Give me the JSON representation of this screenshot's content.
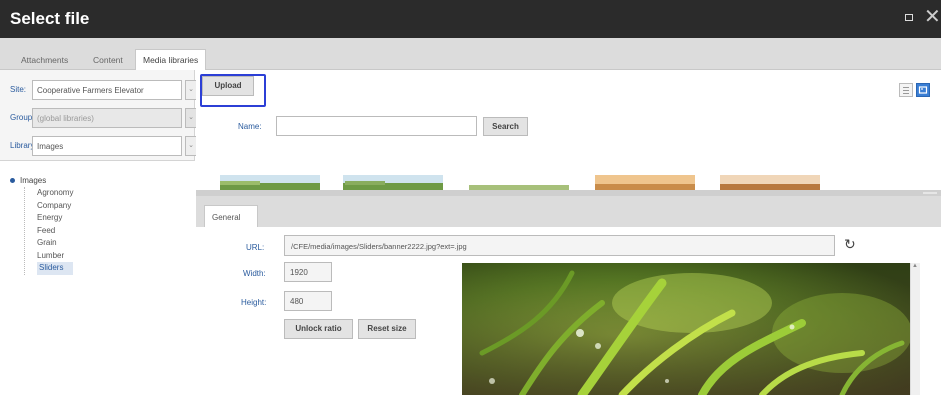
{
  "window": {
    "title": "Select file",
    "maximize_icon": "maximize-icon",
    "close_glyph": "✕"
  },
  "tabs": [
    {
      "label": "Attachments",
      "active": false
    },
    {
      "label": "Content",
      "active": false
    },
    {
      "label": "Media libraries",
      "active": true
    }
  ],
  "filters": {
    "site": {
      "label": "Site:",
      "value": "Cooperative Farmers Elevator"
    },
    "group": {
      "label": "Group:",
      "value": "(global libraries)",
      "disabled": true
    },
    "library": {
      "label": "Library:",
      "value": "Images"
    }
  },
  "tree": {
    "root": "Images",
    "children": [
      "Agronomy",
      "Company",
      "Energy",
      "Feed",
      "Grain",
      "Lumber",
      "Sliders"
    ],
    "selected": "Sliders"
  },
  "toolbar": {
    "upload_label": "Upload",
    "view_icons": [
      "list-view-icon",
      "tile-view-icon"
    ],
    "active_view": "tile-view-icon"
  },
  "search": {
    "name_label": "Name:",
    "name_value": "",
    "search_label": "Search"
  },
  "properties": {
    "tab_label": "General",
    "url_label": "URL:",
    "url_value": "/CFE/media/images/Sliders/banner2222.jpg?ext=.jpg",
    "width_label": "Width:",
    "width_value": "1920",
    "height_label": "Height:",
    "height_value": "480",
    "unlock_label": "Unlock ratio",
    "reset_label": "Reset size",
    "refresh_icon": "refresh-icon"
  },
  "colors": {
    "titlebar": "#2b2b2b",
    "accent_label": "#2a5b9e",
    "focus_outline": "#2c3fd6",
    "active_view": "#3a7ed4"
  }
}
